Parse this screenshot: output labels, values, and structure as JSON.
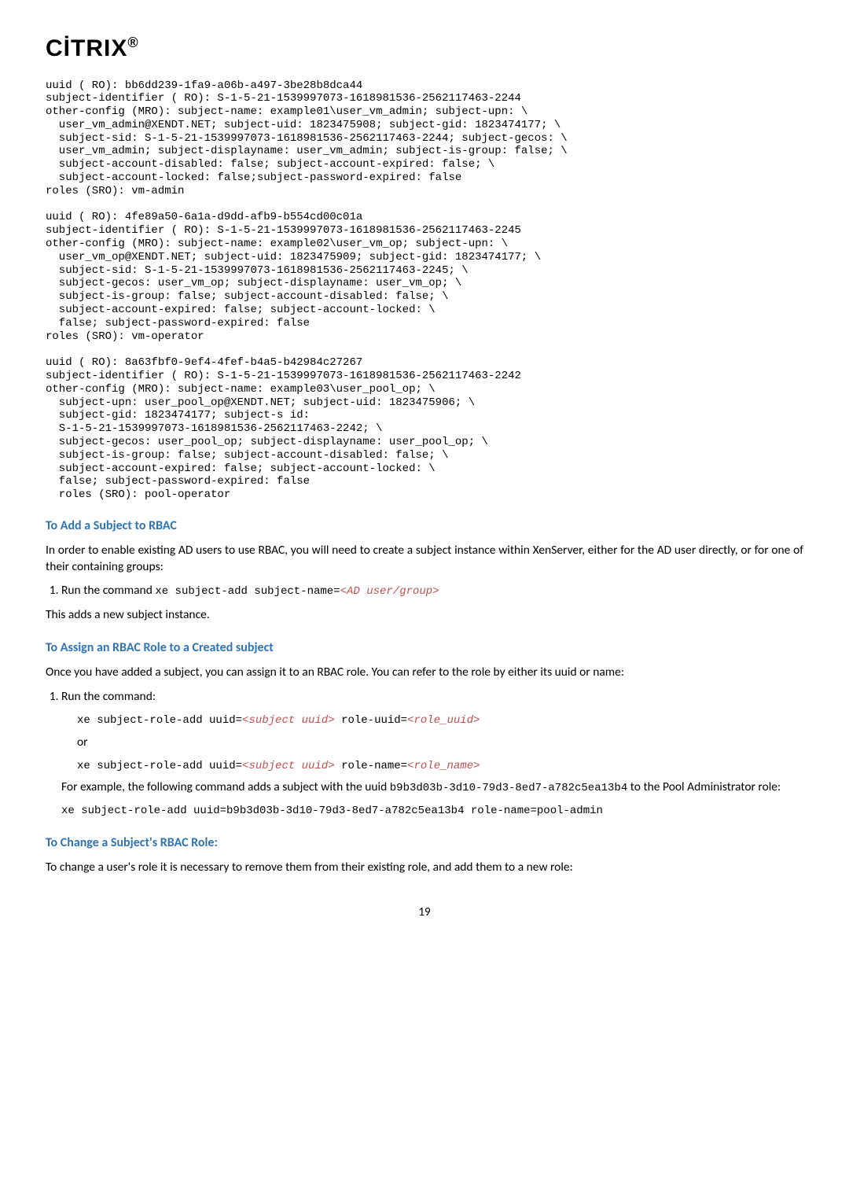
{
  "logo": "CİTRIX",
  "code_block1": "uuid ( RO): bb6dd239-1fa9-a06b-a497-3be28b8dca44\nsubject-identifier ( RO): S-1-5-21-1539997073-1618981536-2562117463-2244\nother-config (MRO): subject-name: example01\\user_vm_admin; subject-upn: \\\n  user_vm_admin@XENDT.NET; subject-uid: 1823475908; subject-gid: 1823474177; \\\n  subject-sid: S-1-5-21-1539997073-1618981536-2562117463-2244; subject-gecos: \\\n  user_vm_admin; subject-displayname: user_vm_admin; subject-is-group: false; \\\n  subject-account-disabled: false; subject-account-expired: false; \\\n  subject-account-locked: false;subject-password-expired: false\nroles (SRO): vm-admin\n\nuuid ( RO): 4fe89a50-6a1a-d9dd-afb9-b554cd00c01a\nsubject-identifier ( RO): S-1-5-21-1539997073-1618981536-2562117463-2245\nother-config (MRO): subject-name: example02\\user_vm_op; subject-upn: \\\n  user_vm_op@XENDT.NET; subject-uid: 1823475909; subject-gid: 1823474177; \\\n  subject-sid: S-1-5-21-1539997073-1618981536-2562117463-2245; \\\n  subject-gecos: user_vm_op; subject-displayname: user_vm_op; \\\n  subject-is-group: false; subject-account-disabled: false; \\\n  subject-account-expired: false; subject-account-locked: \\\n  false; subject-password-expired: false\nroles (SRO): vm-operator\n\nuuid ( RO): 8a63fbf0-9ef4-4fef-b4a5-b42984c27267\nsubject-identifier ( RO): S-1-5-21-1539997073-1618981536-2562117463-2242\nother-config (MRO): subject-name: example03\\user_pool_op; \\\n  subject-upn: user_pool_op@XENDT.NET; subject-uid: 1823475906; \\\n  subject-gid: 1823474177; subject-s id:\n  S-1-5-21-1539997073-1618981536-2562117463-2242; \\\n  subject-gecos: user_pool_op; subject-displayname: user_pool_op; \\\n  subject-is-group: false; subject-account-disabled: false; \\\n  subject-account-expired: false; subject-account-locked: \\\n  false; subject-password-expired: false\n  roles (SRO): pool-operator",
  "h1": "To Add a Subject to RBAC",
  "p1": "In order to enable existing AD users to use RBAC, you will need to create a subject instance within XenServer, either for the AD user directly, or for one of their containing groups:",
  "li1_pre": "Run the command ",
  "li1_cmd": "xe subject-add subject-name=",
  "li1_var": "<AD user/group>",
  "p2": "This adds a new subject instance.",
  "h2": "To Assign an RBAC Role to a Created subject",
  "p3": "Once you have added a subject, you can assign it to an RBAC role. You can refer to the role by either its uuid or name:",
  "li2": "Run the command:",
  "cmd1_a": "xe subject-role-add uuid=",
  "cmd1_b": "<subject uuid>",
  "cmd1_c": " role-uuid=",
  "cmd1_d": "<role_uuid>",
  "or": "or",
  "cmd2_a": "xe subject-role-add uuid=",
  "cmd2_b": "<subject uuid>",
  "cmd2_c": " role-name=",
  "cmd2_d": "<role_name>",
  "p4_a": "For example, the following command adds a subject with the uuid ",
  "p4_b": "b9b3d03b-3d10-79d3-8ed7-a782c5ea13b4",
  "p4_c": " to the Pool Administrator role:",
  "cmd3": "xe subject-role-add uuid=b9b3d03b-3d10-79d3-8ed7-a782c5ea13b4 role-name=pool-admin",
  "h3": "To Change a Subject's RBAC Role:",
  "p5": "To change a user's role it is necessary to remove them from their existing role, and add them to a new role:",
  "page_num": "19"
}
